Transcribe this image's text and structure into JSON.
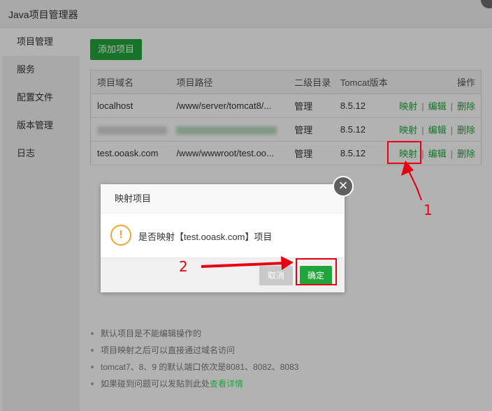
{
  "window": {
    "title": "Java项目管理器"
  },
  "sidebar": {
    "items": [
      {
        "label": "项目管理"
      },
      {
        "label": "服务"
      },
      {
        "label": "配置文件"
      },
      {
        "label": "版本管理"
      },
      {
        "label": "日志"
      }
    ]
  },
  "toolbar": {
    "add_label": "添加项目"
  },
  "table": {
    "headers": {
      "domain": "项目域名",
      "path": "项目路径",
      "subdir": "二级目录",
      "version": "Tomcat版本",
      "ops": "操作"
    },
    "rows": [
      {
        "domain": "localhost",
        "path": "/www/server/tomcat8/...",
        "subdir": "管理",
        "version": "8.5.12",
        "map": "映射",
        "edit": "编辑",
        "delete": "删除"
      },
      {
        "domain": "",
        "path": "",
        "subdir": "管理",
        "version": "8.5.12",
        "map": "映射",
        "edit": "编辑",
        "delete": "删除"
      },
      {
        "domain": "test.ooask.com",
        "path": "/www/wwwroot/test.oo...",
        "subdir": "管理",
        "version": "8.5.12",
        "map": "映射",
        "edit": "编辑",
        "delete": "删除"
      }
    ],
    "separator": "|"
  },
  "notes": {
    "items": [
      "默认项目是不能编辑操作的",
      "项目映射之后可以直接通过域名访问",
      "tomcat7、8、9 的默认端口依次是8081、8082、8083"
    ],
    "last_prefix": "如果碰到问题可以发贴到此处",
    "last_link": "查看详情"
  },
  "dialog": {
    "title": "映射项目",
    "message": "是否映射【test.ooask.com】项目",
    "cancel_label": "取消",
    "ok_label": "确定",
    "close_glyph": "×",
    "warn_glyph": "!"
  },
  "annotations": {
    "step1": "1",
    "step2": "2",
    "color": "#e60012"
  },
  "colors": {
    "accent": "#20a53a",
    "warning": "#f0a531",
    "annotation": "#e60012"
  },
  "icons": {
    "dialog_close": "close-icon",
    "dialog_warning": "warning-icon"
  }
}
